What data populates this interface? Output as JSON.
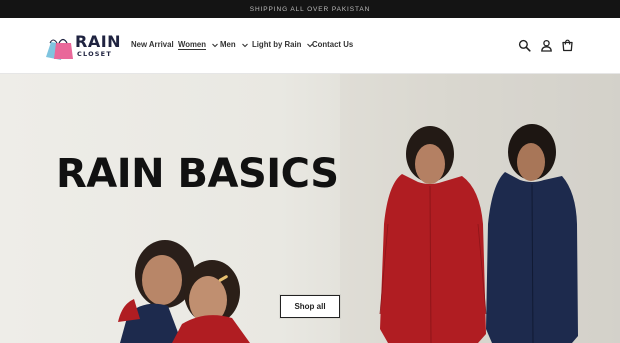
{
  "announcement": "SHIPPING ALL OVER PAKISTAN",
  "logo": {
    "word": "RAIN",
    "sub": "CLOSET"
  },
  "nav": [
    {
      "label": "New Arrival",
      "has_dropdown": false,
      "active": false
    },
    {
      "label": "Women",
      "has_dropdown": true,
      "active": true
    },
    {
      "label": "Men",
      "has_dropdown": true,
      "active": false
    },
    {
      "label": "Light by Rain",
      "has_dropdown": true,
      "active": false
    },
    {
      "label": "Contact Us",
      "has_dropdown": false,
      "active": false
    }
  ],
  "header_icons": [
    "search-icon",
    "account-icon",
    "cart-icon"
  ],
  "hero": {
    "title": "RAIN BASICS",
    "button_label": "Shop all"
  },
  "colors": {
    "announcement_bg": "#141414",
    "brand_navy": "#1f2340",
    "red_garment": "#b01d22",
    "navy_garment": "#1d2a4d"
  }
}
